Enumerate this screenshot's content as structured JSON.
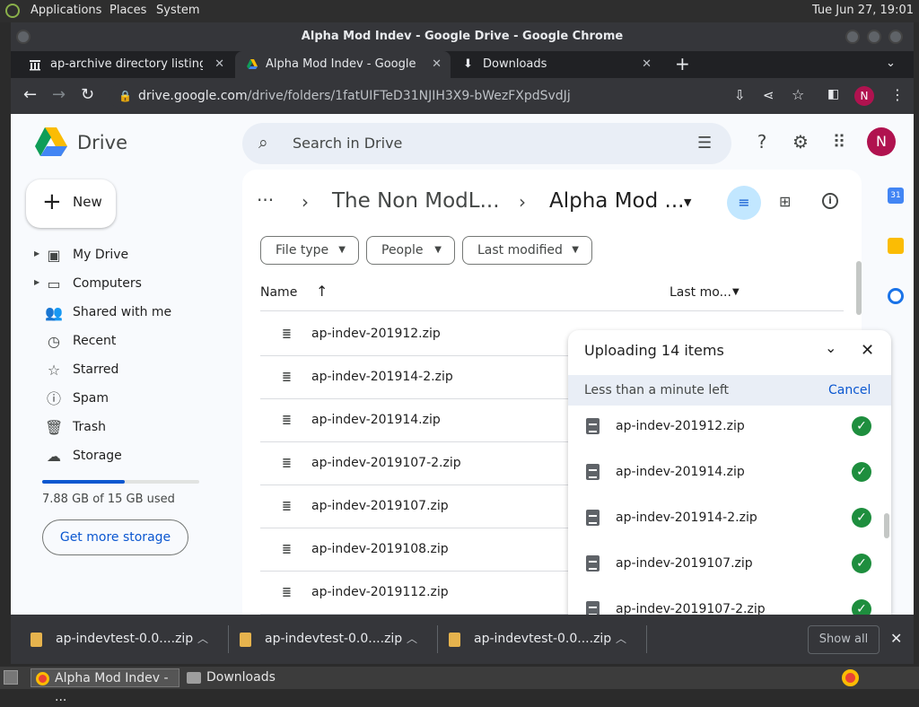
{
  "system_bar": {
    "menus": [
      "Applications",
      "Places",
      "System"
    ],
    "clock": "Tue Jun 27, 19:01"
  },
  "window": {
    "title": "Alpha Mod Indev - Google Drive - Google Chrome"
  },
  "tabs": [
    {
      "label": "ap-archive directory listing",
      "icon": "archive-icon"
    },
    {
      "label": "Alpha Mod Indev - Google Drive",
      "icon": "google-drive-icon"
    },
    {
      "label": "Downloads",
      "icon": "download-icon"
    }
  ],
  "omnibox": {
    "host": "drive.google.com",
    "path": "/drive/folders/1fatUIFTeD31NJIH3X9-bWezFXpdSvdJj"
  },
  "profile_initial": "N",
  "drive": {
    "logo_label": "Drive",
    "search_placeholder": "Search in Drive",
    "new_label": "New",
    "nav": [
      {
        "label": "My Drive",
        "icon": "my-drive-icon",
        "expandable": true
      },
      {
        "label": "Computers",
        "icon": "computers-icon",
        "expandable": true
      },
      {
        "label": "Shared with me",
        "icon": "shared-icon",
        "expandable": false
      },
      {
        "label": "Recent",
        "icon": "clock-icon",
        "expandable": false
      },
      {
        "label": "Starred",
        "icon": "star-icon",
        "expandable": false
      },
      {
        "label": "Spam",
        "icon": "spam-icon",
        "expandable": false
      },
      {
        "label": "Trash",
        "icon": "trash-icon",
        "expandable": false
      },
      {
        "label": "Storage",
        "icon": "cloud-icon",
        "expandable": false
      }
    ],
    "storage_used_fraction": 0.525,
    "storage_text": "7.88 GB of 15 GB used",
    "get_storage_label": "Get more storage",
    "breadcrumb": {
      "parent": "The Non ModL...",
      "current": "Alpha Mod ..."
    },
    "filters": [
      "File type",
      "People",
      "Last modified"
    ],
    "list_header": {
      "name": "Name",
      "sort": "Last mo..."
    },
    "files": [
      "ap-indev-201912.zip",
      "ap-indev-201914-2.zip",
      "ap-indev-201914.zip",
      "ap-indev-2019107-2.zip",
      "ap-indev-2019107.zip",
      "ap-indev-2019108.zip",
      "ap-indev-2019112.zip"
    ]
  },
  "upload_panel": {
    "title": "Uploading 14 items",
    "status": "Less than a minute left",
    "cancel_label": "Cancel",
    "items": [
      "ap-indev-201912.zip",
      "ap-indev-201914.zip",
      "ap-indev-201914-2.zip",
      "ap-indev-2019107.zip",
      "ap-indev-2019107-2.zip"
    ]
  },
  "download_shelf": {
    "items": [
      "ap-indevtest-0.0....zip",
      "ap-indevtest-0.0....zip",
      "ap-indevtest-0.0....zip"
    ],
    "show_all_label": "Show all"
  },
  "taskbar": {
    "tasks": [
      "Alpha Mod Indev - ...",
      "Downloads"
    ]
  },
  "colors": {
    "accent": "#0b57d0",
    "success": "#1e8e3e",
    "avatar": "#b0124f"
  }
}
